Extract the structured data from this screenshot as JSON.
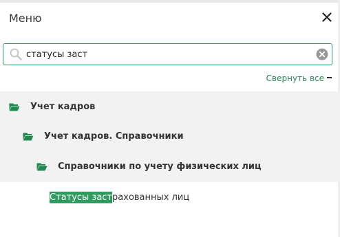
{
  "panel": {
    "title": "Меню"
  },
  "search": {
    "value": "статусы заст",
    "placeholder": ""
  },
  "toolbar": {
    "collapse_all": "Свернуть все"
  },
  "tree": [
    {
      "level": 1,
      "label": "Учет кадров"
    },
    {
      "level": 2,
      "label": "Учет кадров. Справочники"
    },
    {
      "level": 3,
      "label": "Справочники по учету физических лиц"
    }
  ],
  "result": {
    "match": "Статусы заст",
    "rest": "рахованных лиц"
  },
  "icons": {
    "close": "close-icon",
    "search": "search-icon",
    "clear": "clear-search-icon",
    "folder": "folder-open-icon"
  },
  "colors": {
    "accent": "#2e9b5f",
    "folder": "#1f8a4c",
    "tree_bg": "#f2f2f2"
  }
}
